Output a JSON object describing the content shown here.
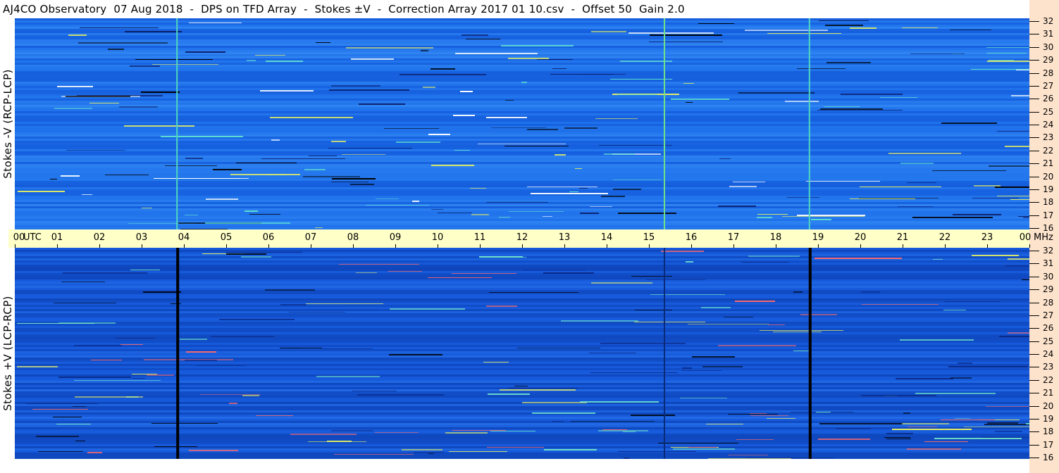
{
  "title": "AJ4CO Observatory  07 Aug 2018  -  DPS on TFD Array  -  Stokes ±V  -  Correction Array 2017 01 10.csv  -  Offset 50  Gain 2.0",
  "panels": [
    {
      "id": "top",
      "ylabel": "Stokes -V (RCP-LCP)",
      "base_color": "#1a6be8",
      "vertical_markers": [
        {
          "hour": 3.82,
          "color": "#4ed8c0"
        },
        {
          "hour": 15.35,
          "color": "#6ee08a"
        },
        {
          "hour": 18.78,
          "color": "#4ed8c0"
        }
      ]
    },
    {
      "id": "bottom",
      "ylabel": "Stokes +V (LCP-RCP)",
      "base_color": "#1457d6",
      "vertical_markers": [
        {
          "hour": 3.82,
          "color": "#000000"
        },
        {
          "hour": 15.35,
          "color": "#0a2a7a"
        },
        {
          "hour": 18.78,
          "color": "#000000"
        }
      ]
    }
  ],
  "time_axis": {
    "labels": [
      "00",
      "01",
      "02",
      "03",
      "04",
      "05",
      "06",
      "07",
      "08",
      "09",
      "10",
      "11",
      "12",
      "13",
      "14",
      "15",
      "16",
      "17",
      "18",
      "19",
      "20",
      "21",
      "22",
      "23",
      "00"
    ],
    "unit_label": "UTC",
    "end_unit_label": "MHz"
  },
  "freq_axis": {
    "labels": [
      "32",
      "31",
      "30",
      "29",
      "28",
      "27",
      "26",
      "25",
      "24",
      "23",
      "22",
      "21",
      "20",
      "19",
      "18",
      "17",
      "16"
    ]
  }
}
